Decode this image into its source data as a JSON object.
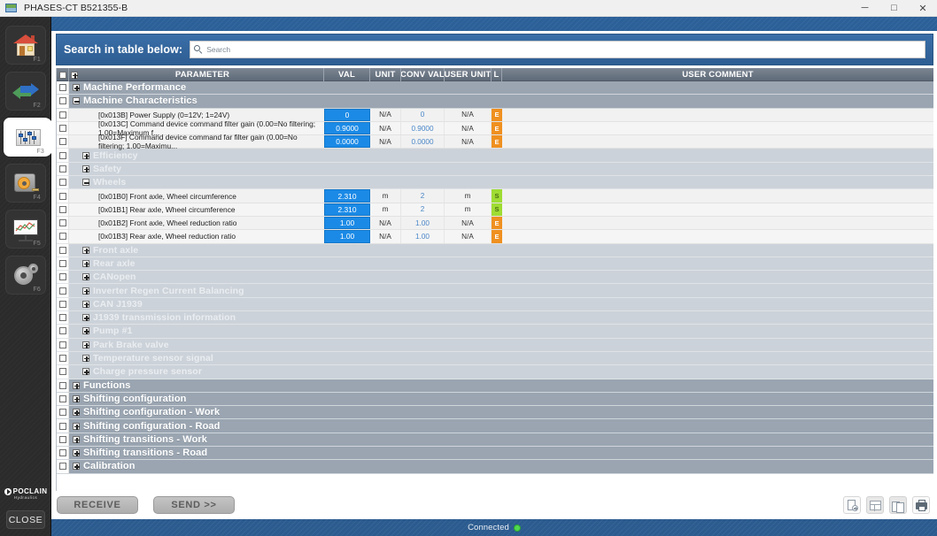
{
  "window": {
    "title": "PHASES-CT B521355-B",
    "app_icon": "app-window-icon",
    "minimize": "─",
    "maximize": "□",
    "close": "✕"
  },
  "sidebar": {
    "items": [
      {
        "icon": "home-icon",
        "fkey": "F1",
        "active": false
      },
      {
        "icon": "exchange-arrows-icon",
        "fkey": "F2",
        "active": false
      },
      {
        "icon": "sliders-icon",
        "fkey": "F3",
        "active": true
      },
      {
        "icon": "tape-measure-icon",
        "fkey": "F4",
        "active": false
      },
      {
        "icon": "chart-board-icon",
        "fkey": "F5",
        "active": false
      },
      {
        "icon": "gear-icon",
        "fkey": "F6",
        "active": false
      }
    ],
    "logo": {
      "name": "POCLAIN",
      "sub": "Hydraulics",
      "mark": "poclain-mark-icon"
    },
    "close_label": "CLOSE"
  },
  "search": {
    "label": "Search in table below:",
    "icon": "search-icon",
    "placeholder": "Search",
    "value": ""
  },
  "table": {
    "columns": {
      "checkbox": "",
      "parameter": "PARAMETER",
      "val": "VAL",
      "unit": "UNIT",
      "conv_val": "CONV VAL",
      "user_unit": "USER UNIT",
      "l": "L",
      "user_comment": "USER COMMENT"
    },
    "rows": [
      {
        "kind": "group1",
        "label": "Machine Performance",
        "expanded": false
      },
      {
        "kind": "group1",
        "label": "Machine Characteristics",
        "expanded": true
      },
      {
        "kind": "data",
        "label": "[0x013B] Power Supply  (0=12V; 1=24V)",
        "val": "0",
        "unit": "N/A",
        "conv_val": "0",
        "user_unit": "N/A",
        "l": "E",
        "comment": ""
      },
      {
        "kind": "data",
        "label": "[0x013C] Command device command filter gain (0.00=No filtering; 1.00=Maximum f...",
        "val": "0.9000",
        "unit": "N/A",
        "conv_val": "0.9000",
        "user_unit": "N/A",
        "l": "E",
        "comment": ""
      },
      {
        "kind": "data",
        "label": "[0x013F] Command device command far filter gain (0.00=No filtering; 1.00=Maximu...",
        "val": "0.0000",
        "unit": "N/A",
        "conv_val": "0.0000",
        "user_unit": "N/A",
        "l": "E",
        "comment": ""
      },
      {
        "kind": "group2",
        "label": "Efficiency",
        "expanded": false
      },
      {
        "kind": "group2",
        "label": "Safety",
        "expanded": false
      },
      {
        "kind": "group2",
        "label": "Wheels",
        "expanded": true
      },
      {
        "kind": "data",
        "label": "[0x01B0] Front axle, Wheel circumference",
        "val": "2.310",
        "unit": "m",
        "conv_val": "2",
        "user_unit": "m",
        "l": "S",
        "comment": ""
      },
      {
        "kind": "data",
        "label": "[0x01B1] Rear axle, Wheel circumference",
        "val": "2.310",
        "unit": "m",
        "conv_val": "2",
        "user_unit": "m",
        "l": "S",
        "comment": ""
      },
      {
        "kind": "data",
        "label": "[0x01B2] Front axle, Wheel reduction ratio",
        "val": "1.00",
        "unit": "N/A",
        "conv_val": "1.00",
        "user_unit": "N/A",
        "l": "E",
        "comment": ""
      },
      {
        "kind": "data",
        "label": "[0x01B3] Rear axle, Wheel reduction ratio",
        "val": "1.00",
        "unit": "N/A",
        "conv_val": "1.00",
        "user_unit": "N/A",
        "l": "E",
        "comment": ""
      },
      {
        "kind": "group2",
        "label": "Front axle",
        "expanded": false
      },
      {
        "kind": "group2",
        "label": "Rear axle",
        "expanded": false
      },
      {
        "kind": "group2",
        "label": "CANopen",
        "expanded": false
      },
      {
        "kind": "group2",
        "label": "Inverter Regen Current Balancing",
        "expanded": false
      },
      {
        "kind": "group2",
        "label": "CAN J1939",
        "expanded": false
      },
      {
        "kind": "group2",
        "label": "J1939 transmission information",
        "expanded": false
      },
      {
        "kind": "group2",
        "label": "Pump #1",
        "expanded": false
      },
      {
        "kind": "group2",
        "label": "Park Brake valve",
        "expanded": false
      },
      {
        "kind": "group2",
        "label": "Temperature sensor signal",
        "expanded": false
      },
      {
        "kind": "group2",
        "label": "Charge pressure sensor",
        "expanded": false
      },
      {
        "kind": "group1",
        "label": "Functions",
        "expanded": false
      },
      {
        "kind": "group1",
        "label": "Shifting configuration",
        "expanded": false
      },
      {
        "kind": "group1",
        "label": "Shifting configuration - Work",
        "expanded": false
      },
      {
        "kind": "group1",
        "label": "Shifting configuration - Road",
        "expanded": false
      },
      {
        "kind": "group1",
        "label": "Shifting transitions - Work",
        "expanded": false
      },
      {
        "kind": "group1",
        "label": "Shifting transitions - Road",
        "expanded": false
      },
      {
        "kind": "group1",
        "label": "Calibration",
        "expanded": false
      }
    ]
  },
  "actions": {
    "receive": "RECEIVE",
    "send": "SEND >>",
    "tools": [
      {
        "icon": "new-document-icon",
        "disabled": false
      },
      {
        "icon": "table-grid-icon",
        "disabled": true
      },
      {
        "icon": "copy-icon",
        "disabled": true
      },
      {
        "icon": "print-icon",
        "disabled": false
      }
    ]
  },
  "status": {
    "text": "Connected",
    "indicator": "status-dot-green"
  },
  "colors": {
    "accent_blue": "#2b6098",
    "val_cell_blue": "#1b8ae6",
    "badge_e_orange": "#ef9020",
    "badge_s_green": "#9fdc33",
    "group1_grey": "#9aa5b1",
    "group2_grey": "#ccd2d9",
    "status_green": "#4fd94f"
  }
}
